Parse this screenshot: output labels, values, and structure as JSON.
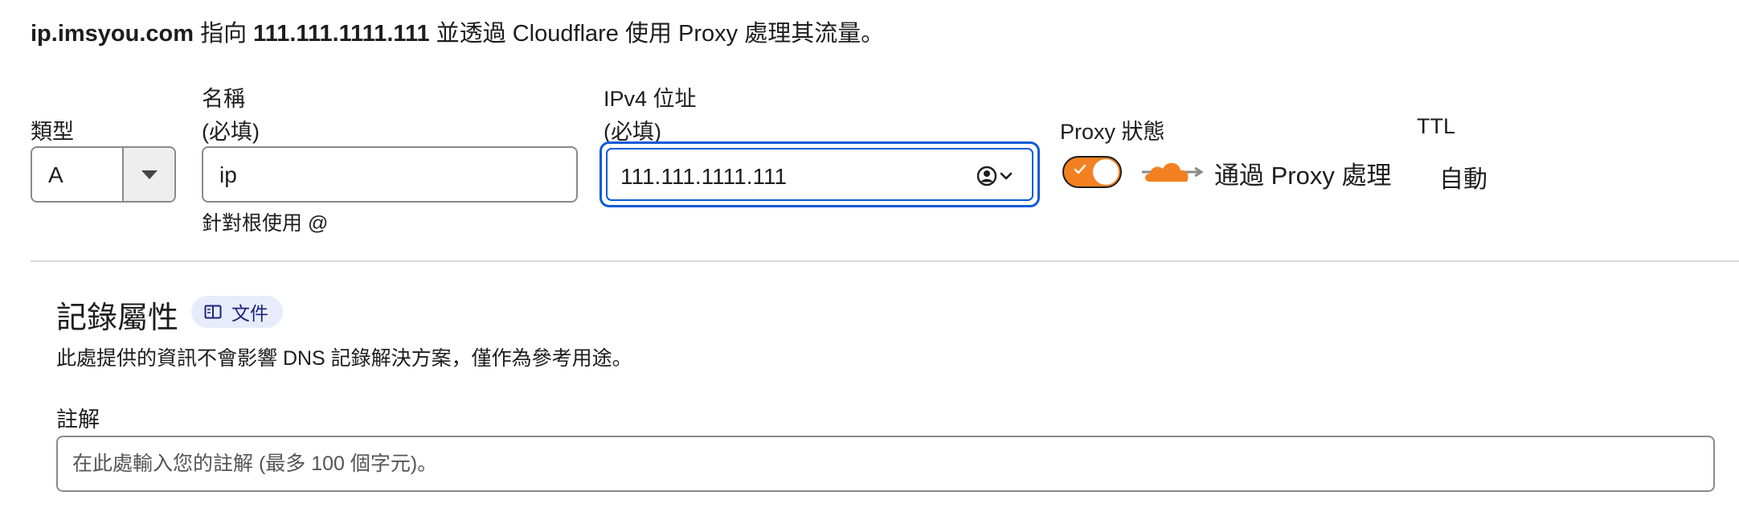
{
  "summary": {
    "name": "ip.imsyou.com",
    "text1": " 指向 ",
    "target": "111.111.1111.111",
    "text2": " 並透過 Cloudflare 使用 Proxy 處理其流量。"
  },
  "type_field": {
    "label": "類型",
    "value": "A",
    "icon": "chevron-down-icon"
  },
  "name_field": {
    "label": "名稱",
    "required": "(必填)",
    "value": "ip",
    "helper": "針對根使用 @"
  },
  "ipv4_field": {
    "label": "IPv4 位址",
    "required": "(必填)",
    "value": "111.111.1111.111",
    "icon": "user-circle-dropdown-icon"
  },
  "proxy_status": {
    "label": "Proxy 狀態",
    "enabled": true,
    "text": "通過 Proxy 處理",
    "icon": "cloud-proxied-icon",
    "color": "#f38020"
  },
  "ttl": {
    "label": "TTL",
    "value": "自動"
  },
  "record_attributes": {
    "title": "記錄屬性",
    "docs_label": "文件",
    "docs_icon": "book-icon",
    "description": "此處提供的資訊不會影響 DNS 記錄解決方案，僅作為參考用途。"
  },
  "comment": {
    "label": "註解",
    "placeholder": "在此處輸入您的註解 (最多 100 個字元)。"
  },
  "colors": {
    "accent_blue": "#0a5ad8",
    "proxy_orange": "#f38020",
    "docs_pill_bg": "#e8ecfa"
  }
}
